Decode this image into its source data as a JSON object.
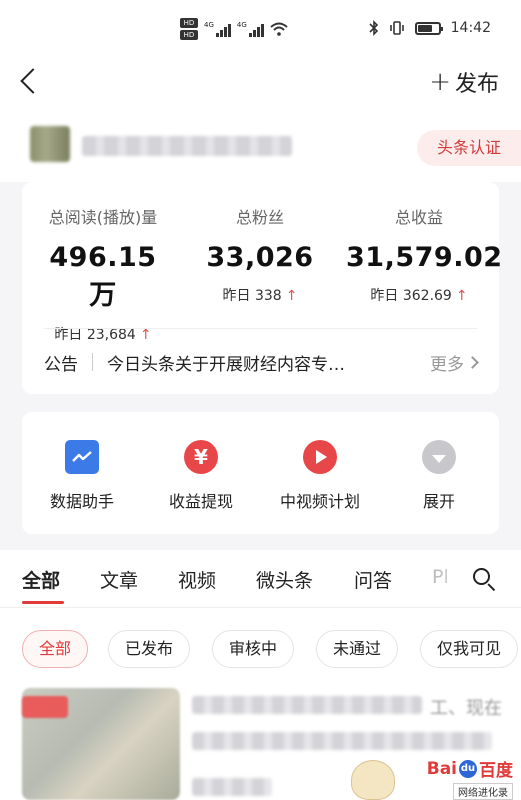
{
  "status_bar": {
    "hd_labels": [
      "HD",
      "HD"
    ],
    "network_labels": [
      "4G",
      "4G"
    ],
    "time": "14:42",
    "icons": [
      "bluetooth-icon",
      "vibrate-icon",
      "battery-icon",
      "wifi-icon",
      "signal-icon"
    ]
  },
  "nav": {
    "back_icon": "chevron-left-icon",
    "publish_plus": "+",
    "publish_label": "发布"
  },
  "profile": {
    "cert_label": "头条认证"
  },
  "stats": {
    "items": [
      {
        "label": "总阅读(播放)量",
        "value": "496.15万",
        "sub": "昨日 23,684",
        "trend": "↑"
      },
      {
        "label": "总粉丝",
        "value": "33,026",
        "sub": "昨日 338",
        "trend": "↑"
      },
      {
        "label": "总收益",
        "value": "31,579.02",
        "sub": "昨日 362.69",
        "trend": "↑"
      }
    ],
    "notice_label": "公告",
    "notice_text": "今日头条关于开展财经内容专…",
    "notice_more": "更多"
  },
  "tools": [
    {
      "label": "数据助手",
      "icon": "chart-icon"
    },
    {
      "label": "收益提现",
      "icon": "yen-icon",
      "glyph": "¥"
    },
    {
      "label": "中视频计划",
      "icon": "play-icon"
    },
    {
      "label": "展开",
      "icon": "expand-icon"
    }
  ],
  "tabs": [
    "全部",
    "文章",
    "视频",
    "微头条",
    "问答",
    "Pl"
  ],
  "filters": [
    "全部",
    "已发布",
    "审核中",
    "未通过",
    "仅我可见"
  ],
  "article": {
    "title_end": "工、现在"
  },
  "watermark": {
    "logo_left": "Bai",
    "logo_paw": "du",
    "logo_right": "百度",
    "sub": "网络进化录"
  },
  "colors": {
    "accent": "#e03a3a",
    "blue": "#3c7ae8",
    "badge_bg": "#fdecec"
  }
}
